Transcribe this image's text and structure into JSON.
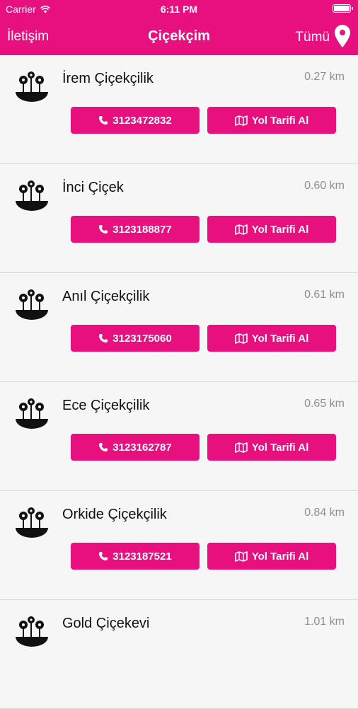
{
  "statusbar": {
    "carrier": "Carrier",
    "time": "6:11 PM"
  },
  "navbar": {
    "left_label": "İletişim",
    "title": "Çiçekçim",
    "right_label": "Tümü"
  },
  "accent_color": "#e8107f",
  "buttons": {
    "directions_label": "Yol Tarifi Al"
  },
  "shops": [
    {
      "name": "İrem Çiçekçilik",
      "distance": "0.27 km",
      "phone": "3123472832"
    },
    {
      "name": "İnci Çiçek",
      "distance": "0.60 km",
      "phone": "3123188877"
    },
    {
      "name": "Anıl Çiçekçilik",
      "distance": "0.61 km",
      "phone": "3123175060"
    },
    {
      "name": "Ece Çiçekçilik",
      "distance": "0.65 km",
      "phone": "3123162787"
    },
    {
      "name": "Orkide Çiçekçilik",
      "distance": "0.84 km",
      "phone": "3123187521"
    },
    {
      "name": "Gold Çiçekevi",
      "distance": "1.01 km",
      "phone": ""
    }
  ]
}
